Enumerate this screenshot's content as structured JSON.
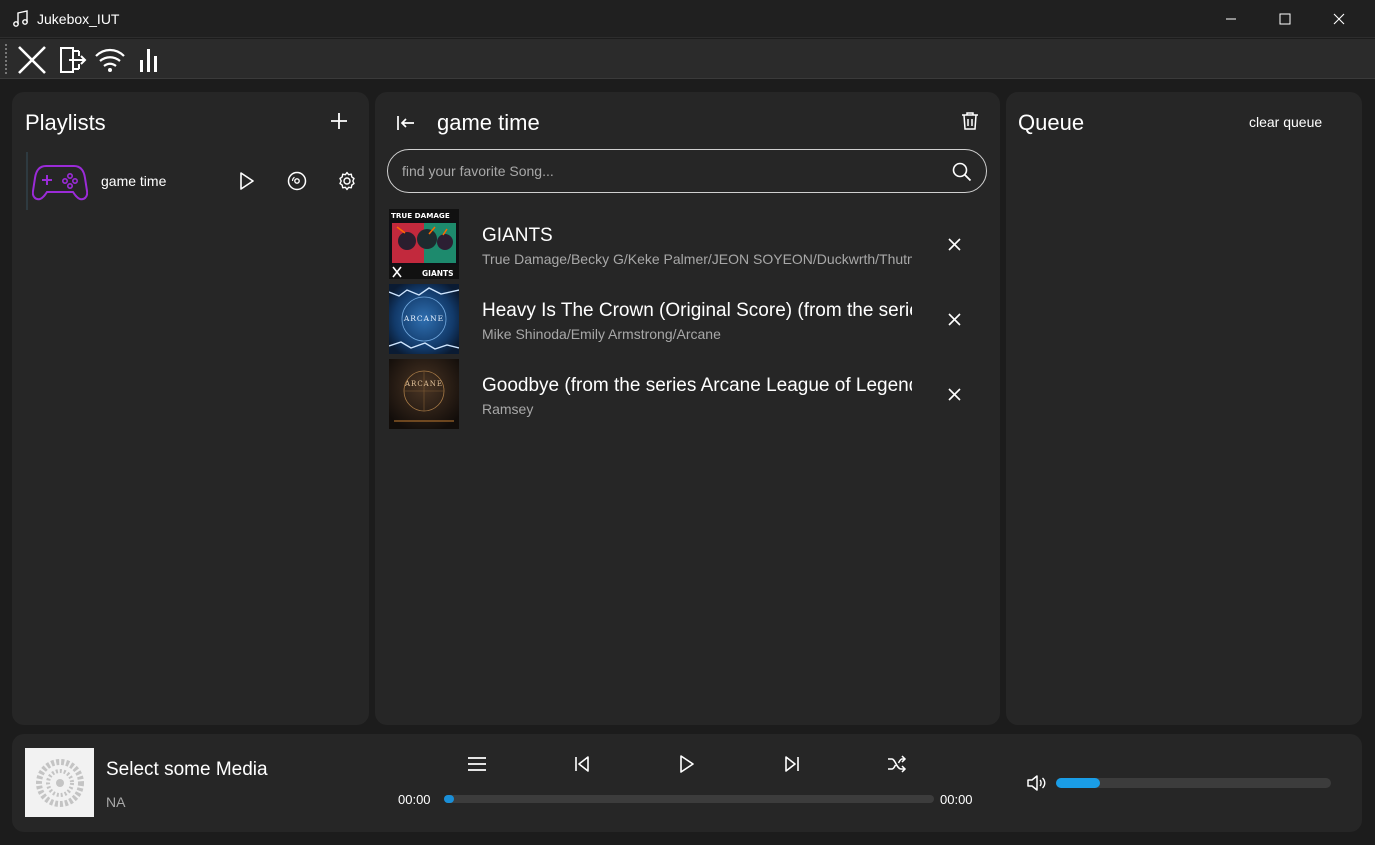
{
  "window": {
    "title": "Jukebox_IUT",
    "app_icon": "music-note-icon"
  },
  "toolbar": {
    "buttons": [
      "close-x-icon",
      "exit-door-icon",
      "wifi-icon",
      "bar-chart-icon"
    ]
  },
  "playlists_panel": {
    "title": "Playlists",
    "items": [
      {
        "name": "game time",
        "thumb": "gamepad-icon"
      }
    ]
  },
  "playlist_view": {
    "title": "game time",
    "search": {
      "placeholder": "find your favorite Song...",
      "value": ""
    },
    "songs": [
      {
        "title": "GIANTS",
        "artist": "True Damage/Becky G/Keke Palmer/JEON SOYEON/Duckwrth/Thutmose",
        "cover_text": "TRUE DAMAGE",
        "cover_sub": "GIANTS"
      },
      {
        "title": "Heavy Is The Crown (Original Score) (from the series Arcane League of Legends)",
        "artist": "Mike Shinoda/Emily Armstrong/Arcane",
        "cover_text": "ARCANE"
      },
      {
        "title": "Goodbye (from the series Arcane League of Legends)",
        "artist": "Ramsey",
        "cover_text": "ARCANE"
      }
    ]
  },
  "queue_panel": {
    "title": "Queue",
    "clear_label": "clear queue"
  },
  "player": {
    "media_title": "Select some Media",
    "media_artist": "NA",
    "time_current": "00:00",
    "time_total": "00:00",
    "progress_fraction": 0.01,
    "volume_fraction": 0.16
  },
  "colors": {
    "accent": "#1a9de6",
    "gamepad": "#9b2bd8",
    "panel": "#262626",
    "background": "#1c1c1c"
  }
}
